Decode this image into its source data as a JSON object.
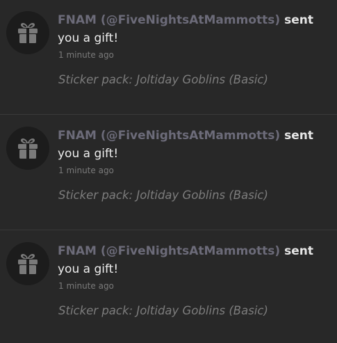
{
  "notifications": [
    {
      "icon": "gift-icon",
      "sender": "FNAM (@FiveNightsAtMammotts)",
      "action_part1": "sent",
      "action_part2": "you a gift!",
      "time": "1 minute ago",
      "detail": "Sticker pack: Joltiday Goblins (Basic)"
    },
    {
      "icon": "gift-icon",
      "sender": "FNAM (@FiveNightsAtMammotts)",
      "action_part1": "sent",
      "action_part2": "you a gift!",
      "time": "1 minute ago",
      "detail": "Sticker pack: Joltiday Goblins (Basic)"
    },
    {
      "icon": "gift-icon",
      "sender": "FNAM (@FiveNightsAtMammotts)",
      "action_part1": "sent",
      "action_part2": "you a gift!",
      "time": "1 minute ago",
      "detail": "Sticker pack: Joltiday Goblins (Basic)"
    }
  ],
  "colors": {
    "background": "#282828",
    "sender": "#6c6b79",
    "text": "#e6e6e6",
    "muted": "#7d7d7d",
    "avatar_bg": "#1c1c1c",
    "icon": "#7a7a7a",
    "divider": "#3a3a3a"
  }
}
